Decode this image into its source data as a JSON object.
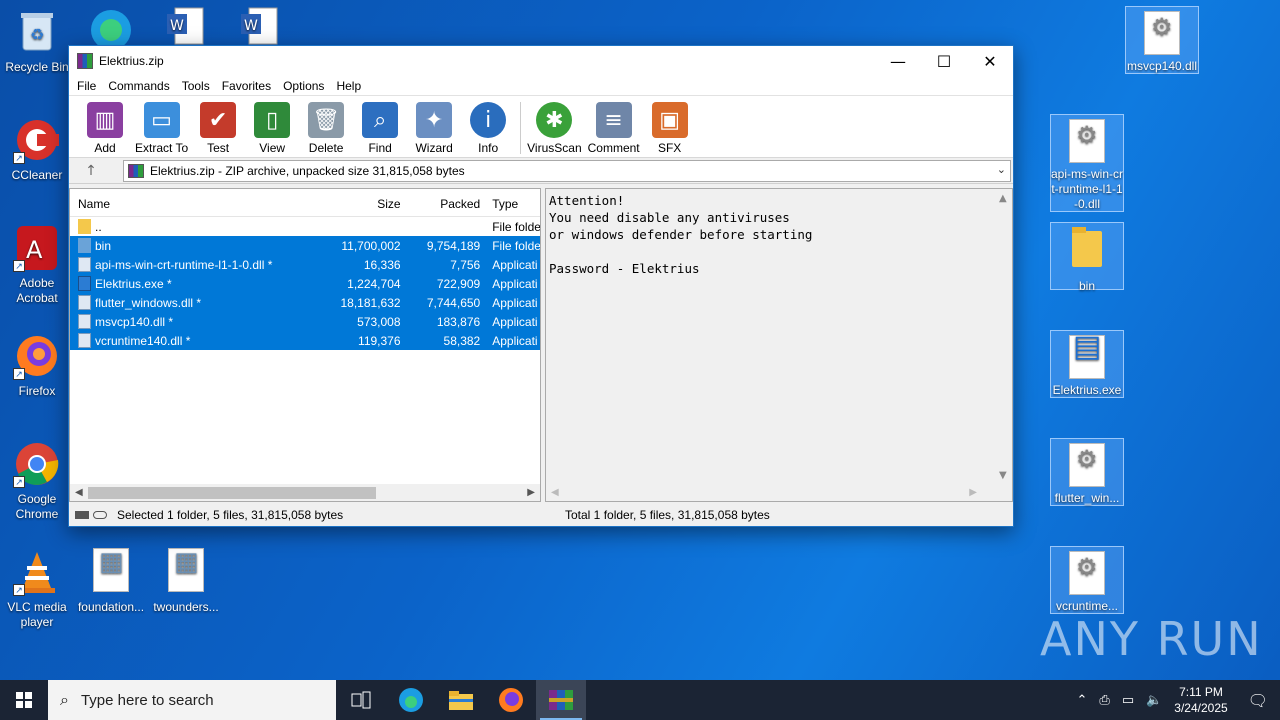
{
  "desktop": {
    "icons_left": [
      {
        "label": "Recycle Bin"
      },
      {
        "label": "CCleaner"
      },
      {
        "label": "Adobe Acrobat"
      },
      {
        "label": "Firefox"
      },
      {
        "label": "Google Chrome"
      },
      {
        "label": "VLC media player"
      },
      {
        "label": "foundation..."
      },
      {
        "label": "twounders..."
      }
    ],
    "icons_right": [
      {
        "label": "msvcp140.dll"
      },
      {
        "label": "api-ms-win-crt-runtime-l1-1-0.dll"
      },
      {
        "label": "bin"
      },
      {
        "label": "Elektrius.exe"
      },
      {
        "label": "flutter_win..."
      },
      {
        "label": "vcruntime..."
      }
    ],
    "watermark": "ANY RUN"
  },
  "window": {
    "title": "Elektrius.zip",
    "menu": [
      "File",
      "Commands",
      "Tools",
      "Favorites",
      "Options",
      "Help"
    ],
    "toolbar": [
      {
        "label": "Add",
        "icon": "books-icon",
        "color": "#8a3fa0"
      },
      {
        "label": "Extract To",
        "icon": "folder-extract-icon",
        "color": "#3c8fdc"
      },
      {
        "label": "Test",
        "icon": "clipboard-check-icon",
        "color": "#c43b2b"
      },
      {
        "label": "View",
        "icon": "open-book-icon",
        "color": "#2f8a3a"
      },
      {
        "label": "Delete",
        "icon": "trash-icon",
        "color": "#8a9aa8"
      },
      {
        "label": "Find",
        "icon": "magnifier-icon",
        "color": "#2d6fc0"
      },
      {
        "label": "Wizard",
        "icon": "magic-wand-icon",
        "color": "#6b8fc2"
      },
      {
        "label": "Info",
        "icon": "info-icon",
        "color": "#2a6dbd"
      },
      {
        "label": "VirusScan",
        "icon": "bug-shield-icon",
        "color": "#3aa13a"
      },
      {
        "label": "Comment",
        "icon": "comment-icon",
        "color": "#6f86a8"
      },
      {
        "label": "SFX",
        "icon": "sfx-box-icon",
        "color": "#d96b2b"
      }
    ],
    "address": "Elektrius.zip - ZIP archive, unpacked size 31,815,058 bytes",
    "columns": {
      "name": "Name",
      "size": "Size",
      "packed": "Packed",
      "type": "Type"
    },
    "rows": [
      {
        "name": "..",
        "size": "",
        "packed": "",
        "type": "File folde",
        "icon": "folder",
        "selected": false
      },
      {
        "name": "bin",
        "size": "11,700,002",
        "packed": "9,754,189",
        "type": "File folde",
        "icon": "folder",
        "selected": true
      },
      {
        "name": "api-ms-win-crt-runtime-l1-1-0.dll *",
        "size": "16,336",
        "packed": "7,756",
        "type": "Applicati",
        "icon": "dll",
        "selected": true
      },
      {
        "name": "Elektrius.exe *",
        "size": "1,224,704",
        "packed": "722,909",
        "type": "Applicati",
        "icon": "exe",
        "selected": true
      },
      {
        "name": "flutter_windows.dll *",
        "size": "18,181,632",
        "packed": "7,744,650",
        "type": "Applicati",
        "icon": "dll",
        "selected": true
      },
      {
        "name": "msvcp140.dll *",
        "size": "573,008",
        "packed": "183,876",
        "type": "Applicati",
        "icon": "dll",
        "selected": true
      },
      {
        "name": "vcruntime140.dll *",
        "size": "119,376",
        "packed": "58,382",
        "type": "Applicati",
        "icon": "dll",
        "selected": true
      }
    ],
    "comment_text": "Attention!\nYou need disable any antiviruses\nor windows defender before starting\n\nPassword - Elektrius",
    "status_left": "Selected 1 folder, 5 files, 31,815,058 bytes",
    "status_right": "Total 1 folder, 5 files, 31,815,058 bytes"
  },
  "taskbar": {
    "search_placeholder": "Type here to search",
    "apps": [
      "task-view-icon",
      "edge-icon",
      "file-explorer-icon",
      "firefox-icon",
      "winrar-icon"
    ],
    "time": "7:11 PM",
    "date": "3/24/2025"
  }
}
